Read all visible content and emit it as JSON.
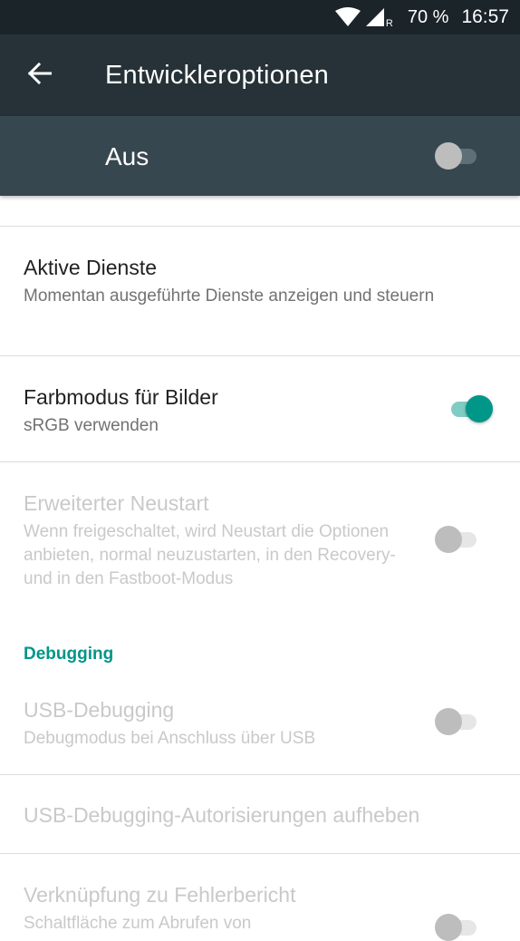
{
  "status_bar": {
    "battery": "70 %",
    "time": "16:57",
    "network_mark": "R",
    "icons": [
      "wifi-icon",
      "cell-signal-icon"
    ]
  },
  "app_bar": {
    "title": "Entwickleroptionen",
    "back_icon": "back-arrow-icon"
  },
  "master_switch": {
    "label": "Aus",
    "state": "off"
  },
  "items": [
    {
      "title": "Aktive Dienste",
      "summary": "Momentan ausgeführte Dienste anzeigen und steuern",
      "enabled": true
    },
    {
      "title": "Farbmodus für Bilder",
      "summary": "sRGB verwenden",
      "toggle": "on",
      "enabled": true
    },
    {
      "title": "Erweiterter Neustart",
      "summary": "Wenn freigeschaltet, wird Neustart die Optionen anbieten, normal neuzustarten, in den Recovery- und in den Fastboot-Modus",
      "toggle": "off",
      "enabled": false
    }
  ],
  "debugging": {
    "header": "Debugging",
    "items": [
      {
        "title": "USB-Debugging",
        "summary": "Debugmodus bei Anschluss über USB",
        "toggle": "off",
        "enabled": false
      },
      {
        "title": "USB-Debugging-Autorisierungen aufheben",
        "enabled": false
      },
      {
        "title": "Verknüpfung zu Fehlerbericht",
        "summary": "Schaltfläche zum Abrufen von",
        "toggle": "off",
        "enabled": false
      }
    ]
  },
  "colors": {
    "status_bar": "#1a2429",
    "app_bar": "#263238",
    "master_bar": "#37474f",
    "accent": "#009688",
    "disabled_text": "#c9c9c9"
  }
}
